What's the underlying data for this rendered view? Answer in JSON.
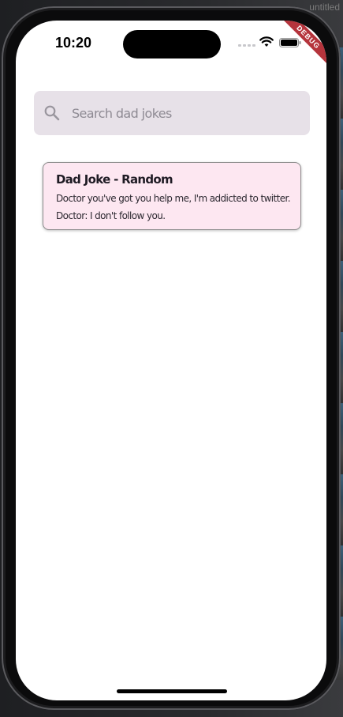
{
  "window": {
    "title": "untitled"
  },
  "status_bar": {
    "time": "10:20"
  },
  "debug_banner": {
    "label": "DEBUG"
  },
  "search": {
    "placeholder": "Search dad jokes",
    "value": ""
  },
  "joke_card": {
    "title": "Dad Joke - Random",
    "lines": [
      "Doctor you've got you help me, I'm addicted to twitter.",
      "Doctor: I don't follow you."
    ]
  },
  "colors": {
    "search_background": "#e7e1e8",
    "card_background": "#fde7f1",
    "debug_ribbon": "#b5343c"
  }
}
